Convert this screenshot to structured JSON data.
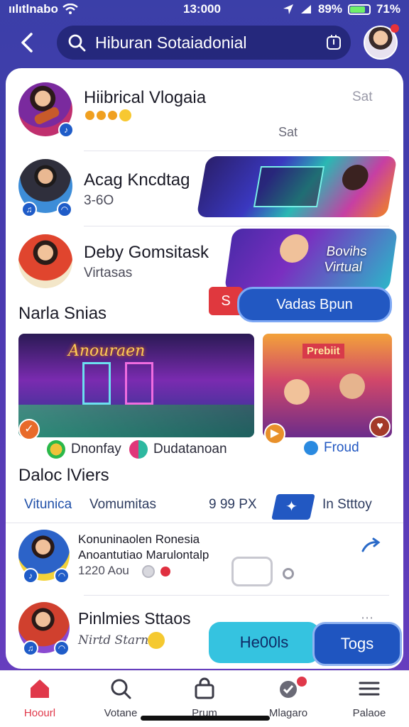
{
  "status_bar": {
    "carrier": "ıılıtlnabo",
    "time": "13:000",
    "battery": "89%",
    "extra": "71%"
  },
  "header": {
    "search_text": "Hiburan Sotaiadonial"
  },
  "colors": {
    "accent": "#1f5cc8",
    "gradient_top": "#3b3fa8",
    "notification": "#e8323a",
    "cyan_button": "#35c3e0"
  },
  "people": [
    {
      "name": "Hiibrical Vlogaia",
      "meta": "Sat",
      "meta2": "Sat"
    },
    {
      "name": "Acag Kncdtag",
      "meta": "3-6O"
    },
    {
      "name": "Deby Gomsitask",
      "meta": "Virtasas"
    }
  ],
  "banners": [
    {
      "label": "Bovihs Virtual"
    }
  ],
  "cta": {
    "red_label": "S",
    "blue_label": "Vadas Bpun"
  },
  "section1": {
    "title": "Narla Snias",
    "tile1": {
      "overlay": "Anouraen",
      "labels": [
        "Dnonfay",
        "Dudatanoan"
      ]
    },
    "tile2": {
      "overlay": "Prebiit",
      "label": "Froud"
    }
  },
  "section2": {
    "title": "Daloc lViers",
    "tabs": [
      "Vitunica",
      "Vomumitas",
      "9 99 PX",
      "In Stttoy"
    ]
  },
  "list": [
    {
      "title": "Konuninaolen Ronesia",
      "subtitle": "Anoantutiao Marulontalp",
      "meta": "1220 Aou"
    },
    {
      "title": "Pinlmies Sttaos",
      "subtitle": "Nirtd Starn"
    }
  ],
  "floating_buttons": {
    "cyan": "He00ls",
    "blue": "Togs"
  },
  "bottom_nav": [
    {
      "label": "Hoourl",
      "icon": "home-icon"
    },
    {
      "label": "Votane",
      "icon": "search-icon"
    },
    {
      "label": "Prum",
      "icon": "bag-icon"
    },
    {
      "label": "Mlagaro",
      "icon": "shield-check-icon"
    },
    {
      "label": "Palaoe",
      "icon": "menu-icon"
    }
  ]
}
